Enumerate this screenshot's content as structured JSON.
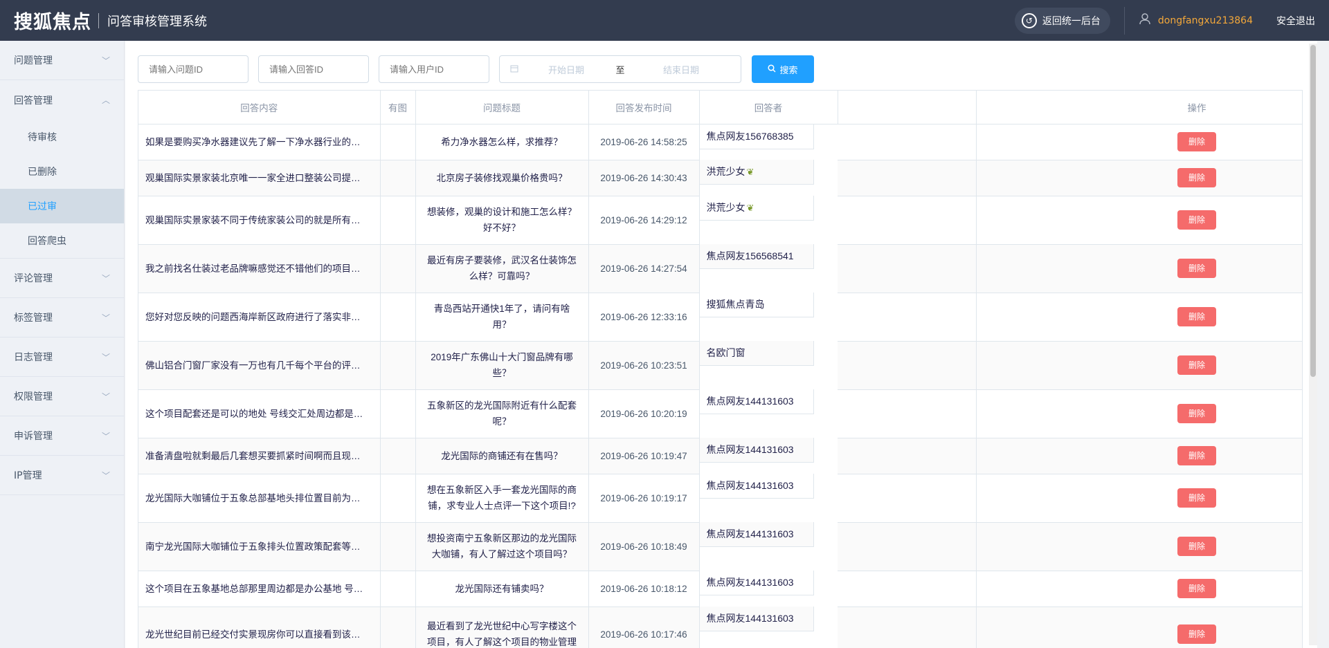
{
  "header": {
    "brand": "搜狐焦点",
    "system_title": "问答审核管理系统",
    "back_label": "返回统一后台",
    "username": "dongfangxu213864",
    "logout_label": "安全退出"
  },
  "sidebar": {
    "menus": [
      {
        "label": "问题管理"
      },
      {
        "label": "回答管理",
        "expanded": true,
        "children": [
          {
            "label": "待审核"
          },
          {
            "label": "已删除"
          },
          {
            "label": "已过审",
            "active": true
          },
          {
            "label": "回答爬虫"
          }
        ]
      },
      {
        "label": "评论管理"
      },
      {
        "label": "标签管理"
      },
      {
        "label": "日志管理"
      },
      {
        "label": "权限管理"
      },
      {
        "label": "申诉管理"
      },
      {
        "label": "IP管理"
      }
    ]
  },
  "search": {
    "question_id_placeholder": "请输入问题ID",
    "answer_id_placeholder": "请输入回答ID",
    "user_id_placeholder": "请输入用户ID",
    "start_date_placeholder": "开始日期",
    "range_separator": "至",
    "end_date_placeholder": "结束日期",
    "search_label": "搜索"
  },
  "table": {
    "columns": [
      "回答内容",
      "有图",
      "问题标题",
      "回答发布时间",
      "回答者",
      "",
      "",
      "操作"
    ],
    "delete_label": "删除",
    "rows": [
      {
        "content": "如果是要购买净水器建议先了解一下净水器行业的…",
        "title": "希力净水器怎么样，求推荐？",
        "time": "2019-06-26 14:58:25",
        "user": "焦点网友156768385"
      },
      {
        "content": "观巢国际实景家装北京唯一一家全进口整装公司提…",
        "title": "北京房子装修找观巢价格贵吗？",
        "time": "2019-06-26 14:30:43",
        "user": "洪荒少女",
        "badge": true
      },
      {
        "content": "观巢国际实景家装不同于传统家装公司的就是所有…",
        "title": "想装修，观巢的设计和施工怎么样？好不好？",
        "time": "2019-06-26 14:29:12",
        "user": "洪荒少女",
        "badge": true
      },
      {
        "content": "我之前找名仕装过老品牌嘛感觉还不错他们的项目…",
        "title": "最近有房子要装修，武汉名仕装饰怎么样？可靠吗？",
        "time": "2019-06-26 14:27:54",
        "user": "焦点网友156568541"
      },
      {
        "content": "您好对您反映的问题西海岸新区政府进行了落实非…",
        "title": "青岛西站开通快1年了，请问有啥用？",
        "time": "2019-06-26 12:33:16",
        "user": "搜狐焦点青岛"
      },
      {
        "content": "佛山铝合门窗厂家没有一万也有几千每个平台的评…",
        "title": "2019年广东佛山十大门窗品牌有哪些？",
        "time": "2019-06-26 10:23:51",
        "user": "名欧门窗"
      },
      {
        "content": "这个项目配套还是可以的地处 号线交汇处周边都是…",
        "title": "五象新区的龙光国际附近有什么配套呢？",
        "time": "2019-06-26 10:20:19",
        "user": "焦点网友144131603"
      },
      {
        "content": "准备清盘啦就剩最后几套想买要抓紧时间啊而且现…",
        "title": "龙光国际的商铺还有在售吗？",
        "time": "2019-06-26 10:19:47",
        "user": "焦点网友144131603"
      },
      {
        "content": "龙光国际大咖铺位于五象总部基地头排位置目前为…",
        "title": "想在五象新区入手一套龙光国际的商铺，求专业人士点评一下这个项目!?",
        "time": "2019-06-26 10:19:17",
        "user": "焦点网友144131603"
      },
      {
        "content": "南宁龙光国际大咖铺位于五象排头位置政策配套等…",
        "title": "想投资南宁五象新区那边的龙光国际大咖铺，有人了解过这个项目吗？",
        "time": "2019-06-26 10:18:49",
        "user": "焦点网友144131603"
      },
      {
        "content": "这个项目在五象基地总部那里周边都是办公基地 号…",
        "title": "龙光国际还有铺卖吗？",
        "time": "2019-06-26 10:18:12",
        "user": "焦点网友144131603"
      },
      {
        "content": "龙光世纪目前已经交付实景现房你可以直接看到该…",
        "title": "最近看到了龙光世纪中心写字楼这个项目，有人了解这个项目的物业管理",
        "time": "2019-06-26 10:17:46",
        "user": "焦点网友144131603"
      }
    ]
  }
}
